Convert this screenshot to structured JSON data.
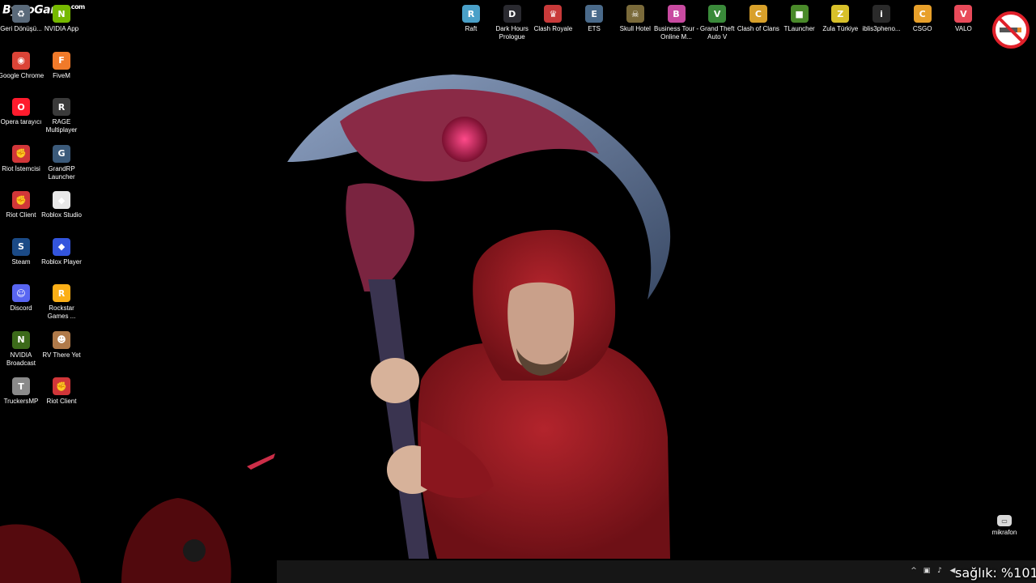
{
  "watermark": {
    "text": "ByNoGame",
    "suffix": ".com"
  },
  "desktop_left": [
    {
      "label": "Geri Dönüşü...",
      "icon": "recycle-bin-icon",
      "color": "#5a6a7a",
      "glyph": "♻"
    },
    {
      "label": "NVIDIA App",
      "icon": "nvidia-icon",
      "color": "#76b900",
      "glyph": "N"
    },
    {
      "label": "Google Chrome",
      "icon": "chrome-icon",
      "color": "#db4437",
      "glyph": "◉"
    },
    {
      "label": "FiveM",
      "icon": "fivem-icon",
      "color": "#f07a2a",
      "glyph": "F"
    },
    {
      "label": "Opera tarayıcı",
      "icon": "opera-icon",
      "color": "#ff1b2d",
      "glyph": "O"
    },
    {
      "label": "RAGE Multiplayer",
      "icon": "rage-icon",
      "color": "#3a3a3a",
      "glyph": "R"
    },
    {
      "label": "Riot İstemcisi",
      "icon": "riot-icon",
      "color": "#d13639",
      "glyph": "✊"
    },
    {
      "label": "GrandRP Launcher",
      "icon": "grandrp-icon",
      "color": "#3b5a7a",
      "glyph": "G"
    },
    {
      "label": "Riot Client",
      "icon": "riot-icon",
      "color": "#d13639",
      "glyph": "✊"
    },
    {
      "label": "Roblox Studio",
      "icon": "roblox-studio-icon",
      "color": "#e8e8e8",
      "glyph": "◆"
    },
    {
      "label": "Steam",
      "icon": "steam-icon",
      "color": "#1b4a86",
      "glyph": "S"
    },
    {
      "label": "Roblox Player",
      "icon": "roblox-icon",
      "color": "#3355dd",
      "glyph": "◆"
    },
    {
      "label": "Discord",
      "icon": "discord-icon",
      "color": "#5865f2",
      "glyph": "☺"
    },
    {
      "label": "Rockstar Games ...",
      "icon": "rockstar-icon",
      "color": "#fcaf17",
      "glyph": "R"
    },
    {
      "label": "NVIDIA Broadcast",
      "icon": "nvidia-broadcast-icon",
      "color": "#3c6a1a",
      "glyph": "N"
    },
    {
      "label": "RV There Yet",
      "icon": "rv-there-yet-icon",
      "color": "#b07a4a",
      "glyph": "☻"
    },
    {
      "label": "TruckersMP",
      "icon": "truckersmp-icon",
      "color": "#8a8a8a",
      "glyph": "T"
    },
    {
      "label": "Riot Client",
      "icon": "riot-icon",
      "color": "#d13639",
      "glyph": "✊"
    }
  ],
  "desktop_top": [
    {
      "label": "Raft",
      "icon": "raft-icon",
      "color": "#4aa0c8",
      "glyph": "R"
    },
    {
      "label": "Dark Hours Prologue",
      "icon": "dark-hours-icon",
      "color": "#2a2a30",
      "glyph": "D"
    },
    {
      "label": "Clash Royale",
      "icon": "clash-royale-icon",
      "color": "#c83a3a",
      "glyph": "♛"
    },
    {
      "label": "ETS",
      "icon": "ets-icon",
      "color": "#4a6a8a",
      "glyph": "E"
    },
    {
      "label": "Skull Hotel",
      "icon": "skull-hotel-icon",
      "color": "#7a6a3a",
      "glyph": "☠"
    },
    {
      "label": "Business Tour - Online M...",
      "icon": "business-tour-icon",
      "color": "#c84aa0",
      "glyph": "B"
    },
    {
      "label": "Grand Theft Auto V",
      "icon": "gta-icon",
      "color": "#3a8a3a",
      "glyph": "V"
    },
    {
      "label": "Clash of Clans",
      "icon": "clash-of-clans-icon",
      "color": "#d8a02a",
      "glyph": "C"
    },
    {
      "label": "TLauncher",
      "icon": "tlauncher-icon",
      "color": "#4a8a2a",
      "glyph": "■"
    },
    {
      "label": "Zula Türkiye",
      "icon": "zula-icon",
      "color": "#d8c02a",
      "glyph": "Z"
    },
    {
      "label": "iblis3pheno...",
      "icon": "game-icon",
      "color": "#2a2a2a",
      "glyph": "i"
    },
    {
      "label": "CSGO",
      "icon": "csgo-icon",
      "color": "#e8a02a",
      "glyph": "C"
    },
    {
      "label": "VALO",
      "icon": "valorant-icon",
      "color": "#e84a5a",
      "glyph": "V"
    }
  ],
  "mic_widget": {
    "label": "mikrafon"
  },
  "overlay": {
    "health": "sağlık: %101"
  },
  "colors": {
    "hoodie": "#9e1a22",
    "scythe_blade": "#5a6a88",
    "scythe_pink": "#a83a5a"
  }
}
